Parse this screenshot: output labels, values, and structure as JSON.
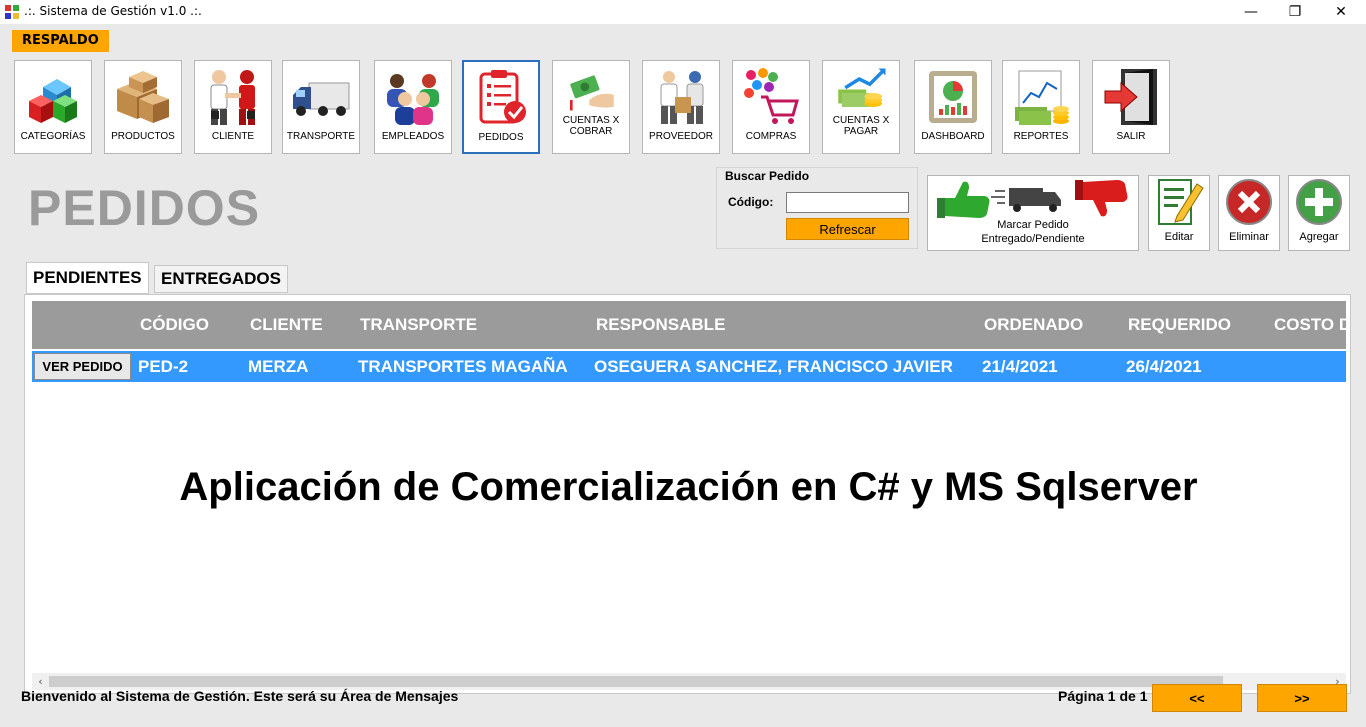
{
  "window": {
    "title": ".:. Sistema de Gestión v1.0 .:.",
    "minimize": "—",
    "restore": "❐",
    "close": "✕"
  },
  "menu": {
    "respaldo": "RESPALDO"
  },
  "toolbar": [
    {
      "key": "categorias",
      "label": "CATEGORÍAS",
      "icon": "cubes-icon"
    },
    {
      "key": "productos",
      "label": "PRODUCTOS",
      "icon": "boxes-icon"
    },
    {
      "key": "cliente",
      "label": "CLIENTE",
      "icon": "handshake-icon"
    },
    {
      "key": "transporte",
      "label": "TRANSPORTE",
      "icon": "truck-icon"
    },
    {
      "key": "empleados",
      "label": "EMPLEADOS",
      "icon": "people-icon"
    },
    {
      "key": "pedidos",
      "label": "PEDIDOS",
      "icon": "clipboard-check-icon",
      "active": true
    },
    {
      "key": "cuentas_cobrar",
      "label": "CUENTAS X\nCOBRAR",
      "icon": "money-hand-icon"
    },
    {
      "key": "proveedor",
      "label": "PROVEEDOR",
      "icon": "supplier-icon"
    },
    {
      "key": "compras",
      "label": "COMPRAS",
      "icon": "shopping-cart-icon"
    },
    {
      "key": "cuentas_pagar",
      "label": "CUENTAS X\nPAGAR",
      "icon": "money-arrow-icon"
    },
    {
      "key": "dashboard",
      "label": "DASHBOARD",
      "icon": "dashboard-chart-icon"
    },
    {
      "key": "reportes",
      "label": "REPORTES",
      "icon": "report-money-icon"
    },
    {
      "key": "salir",
      "label": "SALIR",
      "icon": "exit-door-icon"
    }
  ],
  "page_title": "PEDIDOS",
  "search": {
    "title": "Buscar Pedido",
    "code_label": "Código:",
    "code_value": "",
    "refresh_label": "Refrescar"
  },
  "actions": {
    "mark_label_1": "Marcar Pedido",
    "mark_label_2": "Entregado/Pendiente",
    "edit_label": "Editar",
    "delete_label": "Eliminar",
    "add_label": "Agregar"
  },
  "tabs": [
    {
      "label": "PENDIENTES",
      "active": true
    },
    {
      "label": "ENTREGADOS",
      "active": false
    }
  ],
  "grid": {
    "columns": [
      "CÓDIGO",
      "CLIENTE",
      "TRANSPORTE",
      "RESPONSABLE",
      "ORDENADO",
      "REQUERIDO",
      "COSTO D"
    ],
    "rows": [
      {
        "button": "VER PEDIDO",
        "codigo": "PED-2",
        "cliente": "MERZA",
        "transporte": "TRANSPORTES MAGAÑA",
        "responsable": "OSEGUERA SANCHEZ, FRANCISCO JAVIER",
        "ordenado": "21/4/2021",
        "requerido": "26/4/2021"
      }
    ]
  },
  "watermark": "Aplicación de Comercialización en C# y MS Sqlserver",
  "status": {
    "message": "Bienvenido al Sistema de Gestión. Este será su Área de Mensajes",
    "page_info": "Página 1 de 1",
    "prev": "<<",
    "next": ">>"
  },
  "colors": {
    "accent_orange": "#ffa500",
    "row_selected": "#3399ff",
    "grid_header": "#9b9b9b",
    "active_border": "#2b6fbd"
  }
}
